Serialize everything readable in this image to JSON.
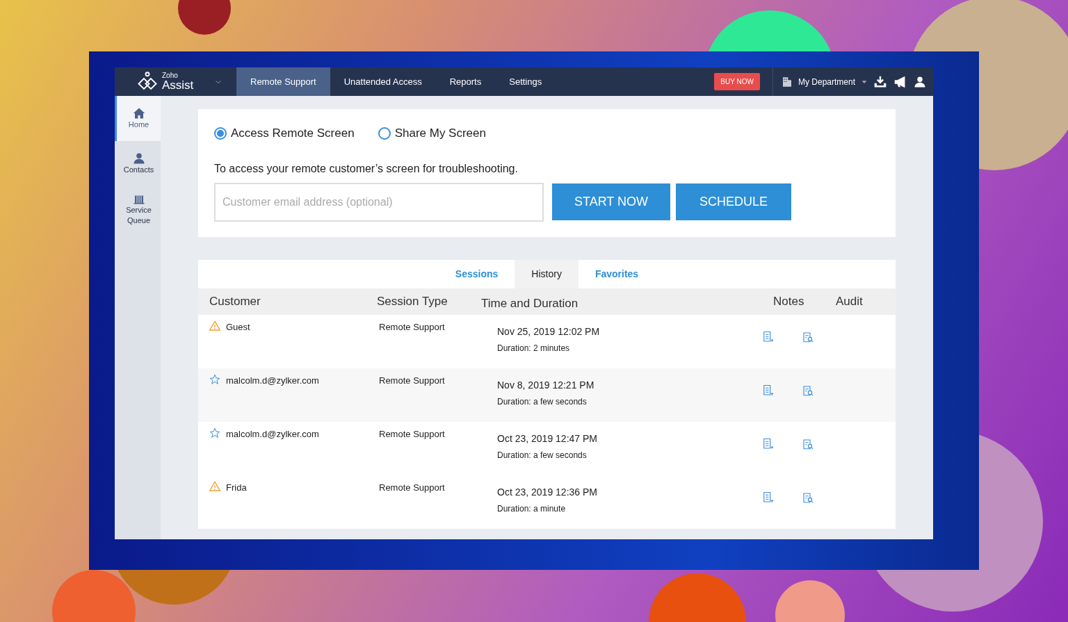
{
  "app": {
    "logo_small": "Zoho",
    "logo_name": "Assist"
  },
  "nav": [
    {
      "label": "Remote Support",
      "selected": true
    },
    {
      "label": "Unattended Access",
      "selected": false
    },
    {
      "label": "Reports",
      "selected": false
    },
    {
      "label": "Settings",
      "selected": false
    }
  ],
  "buy_button": "BUY NOW",
  "department": "My Department",
  "sidebar": [
    {
      "label": "Home",
      "kind": "home",
      "selected": true
    },
    {
      "label": "Contacts",
      "kind": "contacts",
      "selected": false
    },
    {
      "label": "Service Queue",
      "kind": "queue",
      "selected": false
    }
  ],
  "modes": [
    {
      "label": "Access Remote Screen",
      "selected": true
    },
    {
      "label": "Share My Screen",
      "selected": false
    }
  ],
  "description": "To access your remote customer’s screen for troubleshooting.",
  "email": {
    "placeholder": "Customer email address (optional)"
  },
  "actions": [
    "START NOW",
    "SCHEDULE"
  ],
  "tabs": [
    {
      "label": "Sessions",
      "selected": false
    },
    {
      "label": "History",
      "selected": true
    },
    {
      "label": "Favorites",
      "selected": false
    }
  ],
  "table": {
    "columns": [
      "Customer",
      "Session Type",
      "Time and Duration",
      "Notes",
      "Audit"
    ],
    "rows": [
      {
        "kind": "warning",
        "customer": "Guest",
        "type": "Remote Support",
        "time": "Nov 25, 2019 12:02 PM",
        "duration": "Duration: 2 minutes"
      },
      {
        "kind": "favorite",
        "customer": "malcolm.d@zylker.com",
        "type": "Remote Support",
        "time": "Nov 8, 2019 12:21 PM",
        "duration": "Duration: a few seconds"
      },
      {
        "kind": "favorite",
        "customer": "malcolm.d@zylker.com",
        "type": "Remote Support",
        "time": "Oct 23, 2019 12:47 PM",
        "duration": "Duration: a few seconds"
      },
      {
        "kind": "warning",
        "customer": "Frida",
        "type": "Remote Support",
        "time": "Oct 23, 2019 12:36 PM",
        "duration": "Duration: a minute"
      }
    ]
  }
}
